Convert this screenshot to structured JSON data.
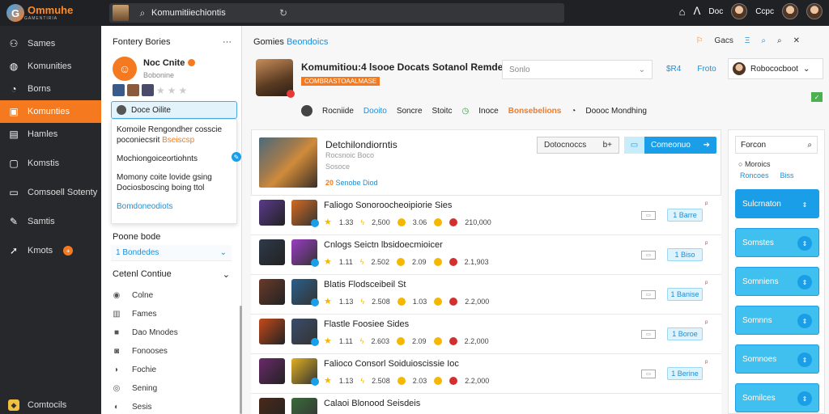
{
  "topbar": {
    "logo_text": "Ommuhe",
    "logo_sub": "GAMENTIRIA",
    "search_value": "Komumitiiechiontis",
    "username": "Doc",
    "user2": "Ccpc"
  },
  "nav": {
    "items": [
      {
        "label": "Sames",
        "icon": "⚇"
      },
      {
        "label": "Komunities",
        "icon": "◍"
      },
      {
        "label": "Borns",
        "icon": "◔"
      },
      {
        "label": "Komunties",
        "icon": "▣"
      },
      {
        "label": "Hamles",
        "icon": "▤"
      },
      {
        "label": "Komstis",
        "icon": "▢"
      },
      {
        "label": "Comsoell Sotenty",
        "icon": "▭"
      },
      {
        "label": "Samtis",
        "icon": "✎"
      },
      {
        "label": "Kmots",
        "icon": "➚",
        "badge": "+"
      }
    ],
    "bottom_label": "Comtocils"
  },
  "col2": {
    "title": "Fontery Bories",
    "more": "···",
    "profile_name": "Noc Cnite",
    "profile_sub": "Bobonine",
    "selected_field": "Doce Oilite",
    "popup": {
      "line1": "Komoile Rengondher cosscie",
      "line2": "poconiecsrit",
      "line2_orange": "Bseiscsp",
      "line3": "Mochiongoiceortiohnts",
      "line4": "Momony coite lovide gsing",
      "line5": "Dociosboscing boing ttol",
      "link": "Bomdoneodiots"
    },
    "section1": "Poone bode",
    "dropdown_value": "1 Bondedes",
    "section2": "Cetenl Contiue",
    "list": [
      {
        "label": "Colne",
        "icon": "◉"
      },
      {
        "label": "Fames",
        "icon": "▥"
      },
      {
        "label": "Dao Mnodes",
        "icon": "■"
      },
      {
        "label": "Fonooses",
        "icon": "◙"
      },
      {
        "label": "Fochie",
        "icon": "◗"
      },
      {
        "label": "Sening",
        "icon": "◎"
      },
      {
        "label": "Sesis",
        "icon": "◐"
      }
    ]
  },
  "main": {
    "breadcrumb_a": "Gomies",
    "breadcrumb_b": "Beondoics",
    "head_right": [
      "Gacs",
      "Ξ",
      "⌕",
      "⌕",
      "✕"
    ],
    "game_title": "Komumitiou:4 lsooe Docats Sotanol Remde ...",
    "game_tag": "COMBRASTOAALMASE",
    "meta": {
      "name": "Rocniide",
      "link": "Dooito",
      "m1": "Soncre",
      "m2": "Stoitc",
      "m3": "Inoce",
      "m4_orange": "Bonsebelions",
      "m5": "Doooc Mondhing"
    },
    "hdr_select": "Sonlo",
    "hdr_links": [
      "$R4",
      "Froto"
    ],
    "hdr_user": "Robococboot",
    "feature": {
      "title": "Detchilondiorntis",
      "sub": "Rocsnoic Boco",
      "sub2": "Sosoce",
      "meta_orange": "20",
      "meta_blue": "Senobe Diod",
      "select_label": "Dotocnoccs",
      "select_extra": "b+",
      "button_label": "Comeonuo"
    },
    "rows": [
      {
        "title": "Faliogo Sonoroocheoipiorie Sies",
        "s1": "1.33",
        "s2": "2,500",
        "s3": "3.06",
        "s4": "210,000",
        "btn": "1 Barre",
        "flag": "ᵖ",
        "c1": "#5b3a8c",
        "c2": "#d46b20"
      },
      {
        "title": "Cnlogs Seictn lbsidoecmioicer",
        "s1": "1.11",
        "s2": "2.502",
        "s3": "2.09",
        "s4": "2.1,903",
        "btn": "1 Biso",
        "flag": "ᵖ",
        "c1": "#2f3a4a",
        "c2": "#9b3cc4"
      },
      {
        "title": "Blatis Flodsceibeil St",
        "s1": "1.13",
        "s2": "2.508",
        "s3": "1.03",
        "s4": "2.2,000",
        "btn": "1 Banise",
        "flag": "ᵖ",
        "c1": "#6a3a2a",
        "c2": "#2a5f8a"
      },
      {
        "title": "Flastle Foosiee Sides",
        "s1": "1.11",
        "s2": "2.603",
        "s3": "2.09",
        "s4": "2.2,000",
        "btn": "1 Boroe",
        "flag": "ᵖ",
        "c1": "#c44a1a",
        "c2": "#3a4c6a"
      },
      {
        "title": "Falioco Consorl Soiduioscissie Ioc",
        "s1": "1.13",
        "s2": "2.508",
        "s3": "2.03",
        "s4": "2.2,000",
        "btn": "1 Berine",
        "flag": "ᵖ",
        "c1": "#6a2a6a",
        "c2": "#e0b020"
      },
      {
        "title": "Calaoi Blonood Seisdeis",
        "s1": "",
        "s2": "",
        "s3": "",
        "s4": "",
        "btn": "",
        "flag": "",
        "c1": "#4a2a1a",
        "c2": "#3a6a3a"
      }
    ]
  },
  "rpanel": {
    "search": "Forcon",
    "option": "Moroics",
    "links": [
      "Roncoes",
      "Biss"
    ],
    "buttons": [
      "Sulcrnaton",
      "Somstes",
      "Somniens",
      "Somnns",
      "Somnoes",
      "Somilces"
    ]
  }
}
